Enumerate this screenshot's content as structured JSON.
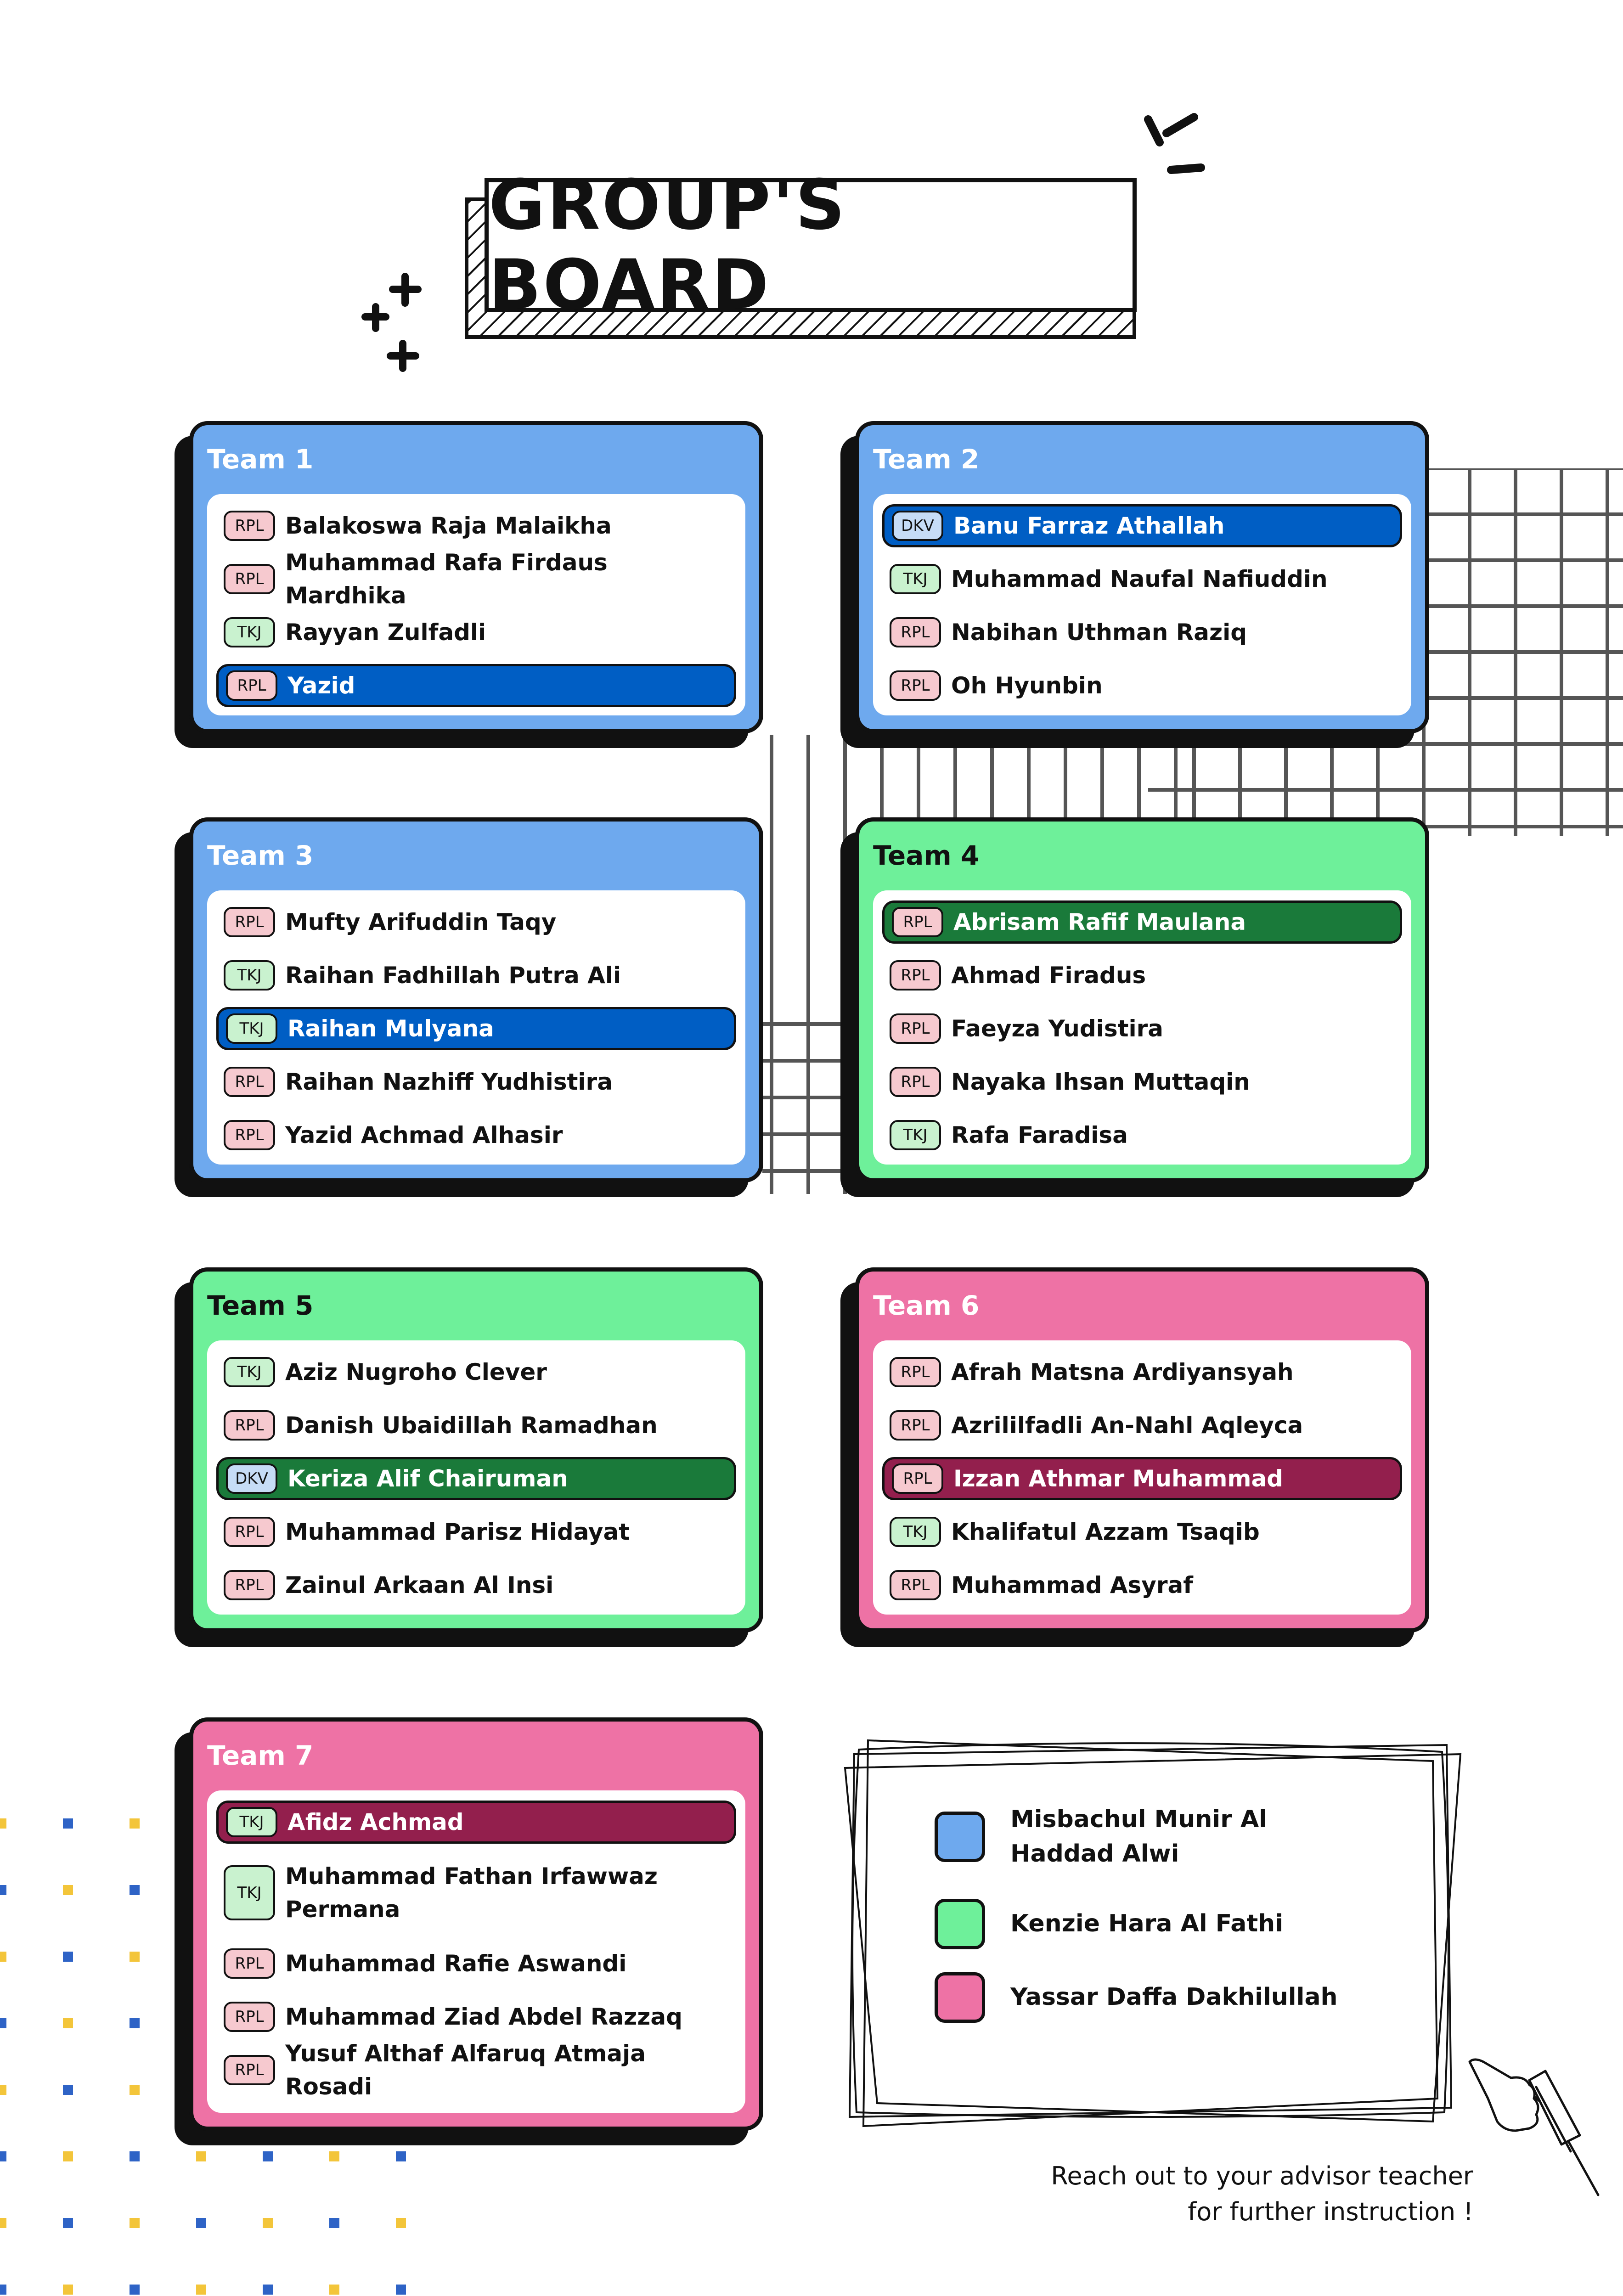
{
  "title": "GROUP'S BOARD",
  "teams": [
    {
      "name": "Team 1",
      "color": "blue",
      "members": [
        {
          "tag": "RPL",
          "name": "Balakoswa Raja Malaikha"
        },
        {
          "tag": "RPL",
          "name": "Muhammad Rafa Firdaus Mardhika"
        },
        {
          "tag": "TKJ",
          "name": "Rayyan Zulfadli"
        },
        {
          "tag": "RPL",
          "name": "Yazid",
          "highlight": true
        }
      ]
    },
    {
      "name": "Team 2",
      "color": "blue",
      "members": [
        {
          "tag": "DKV",
          "name": "Banu Farraz Athallah",
          "highlight": true
        },
        {
          "tag": "TKJ",
          "name": "Muhammad Naufal Nafiuddin"
        },
        {
          "tag": "RPL",
          "name": "Nabihan Uthman Raziq"
        },
        {
          "tag": "RPL",
          "name": "Oh Hyunbin"
        }
      ]
    },
    {
      "name": "Team 3",
      "color": "blue",
      "members": [
        {
          "tag": "RPL",
          "name": "Mufty Arifuddin Taqy"
        },
        {
          "tag": "TKJ",
          "name": "Raihan Fadhillah Putra Ali"
        },
        {
          "tag": "TKJ",
          "name": "Raihan Mulyana",
          "highlight": true
        },
        {
          "tag": "RPL",
          "name": "Raihan Nazhiff Yudhistira"
        },
        {
          "tag": "RPL",
          "name": "Yazid Achmad Alhasir"
        }
      ]
    },
    {
      "name": "Team 4",
      "color": "green",
      "members": [
        {
          "tag": "RPL",
          "name": "Abrisam Rafif Maulana",
          "highlight": true
        },
        {
          "tag": "RPL",
          "name": "Ahmad Firadus"
        },
        {
          "tag": "RPL",
          "name": "Faeyza Yudistira"
        },
        {
          "tag": "RPL",
          "name": "Nayaka Ihsan Muttaqin"
        },
        {
          "tag": "TKJ",
          "name": "Rafa Faradisa"
        }
      ]
    },
    {
      "name": "Team 5",
      "color": "green",
      "members": [
        {
          "tag": "TKJ",
          "name": "Aziz Nugroho Clever"
        },
        {
          "tag": "RPL",
          "name": "Danish Ubaidillah Ramadhan"
        },
        {
          "tag": "DKV",
          "name": "Keriza Alif Chairuman",
          "highlight": true
        },
        {
          "tag": "RPL",
          "name": "Muhammad Parisz Hidayat"
        },
        {
          "tag": "RPL",
          "name": "Zainul Arkaan Al Insi"
        }
      ]
    },
    {
      "name": "Team 6",
      "color": "pink",
      "members": [
        {
          "tag": "RPL",
          "name": "Afrah Matsna Ardiyansyah"
        },
        {
          "tag": "RPL",
          "name": "Azrililfadli An-Nahl Aqleyca"
        },
        {
          "tag": "RPL",
          "name": "Izzan Athmar Muhammad",
          "highlight": true
        },
        {
          "tag": "TKJ",
          "name": "Khalifatul Azzam Tsaqib"
        },
        {
          "tag": "RPL",
          "name": "Muhammad Asyraf"
        }
      ]
    },
    {
      "name": "Team 7",
      "color": "pink",
      "members": [
        {
          "tag": "TKJ",
          "name": "Afidz Achmad",
          "highlight": true
        },
        {
          "tag": "TKJ",
          "name": "Muhammad Fathan Irfawwaz Permana"
        },
        {
          "tag": "RPL",
          "name": "Muhammad Rafie Aswandi"
        },
        {
          "tag": "RPL",
          "name": "Muhammad Ziad Abdel Razzaq"
        },
        {
          "tag": "RPL",
          "name": "Yusuf Althaf Alfaruq Atmaja Rosadi"
        }
      ]
    }
  ],
  "legend": [
    {
      "color": "blue",
      "name": "Misbachul Munir Al Haddad Alwi"
    },
    {
      "color": "green",
      "name": "Kenzie Hara Al Fathi"
    },
    {
      "color": "pink",
      "name": "Yassar Daffa Dakhilullah"
    }
  ],
  "footer_note": "Reach out to your advisor teacher for further instruction !",
  "colors": {
    "blue": "#6ea9ee",
    "green": "#6ef09a",
    "pink": "#ee72a5",
    "highlight_blue": "#005ec4",
    "highlight_green": "#1a7a3a",
    "highlight_pink": "#931f4d",
    "tag_RPL": "#f6c9cf",
    "tag_TKJ": "#c9f2cf",
    "tag_DKV": "#c6dcf6"
  },
  "icons": [
    "sparkle-lines-icon",
    "cross-stars-icon",
    "pointing-hand-icon"
  ]
}
